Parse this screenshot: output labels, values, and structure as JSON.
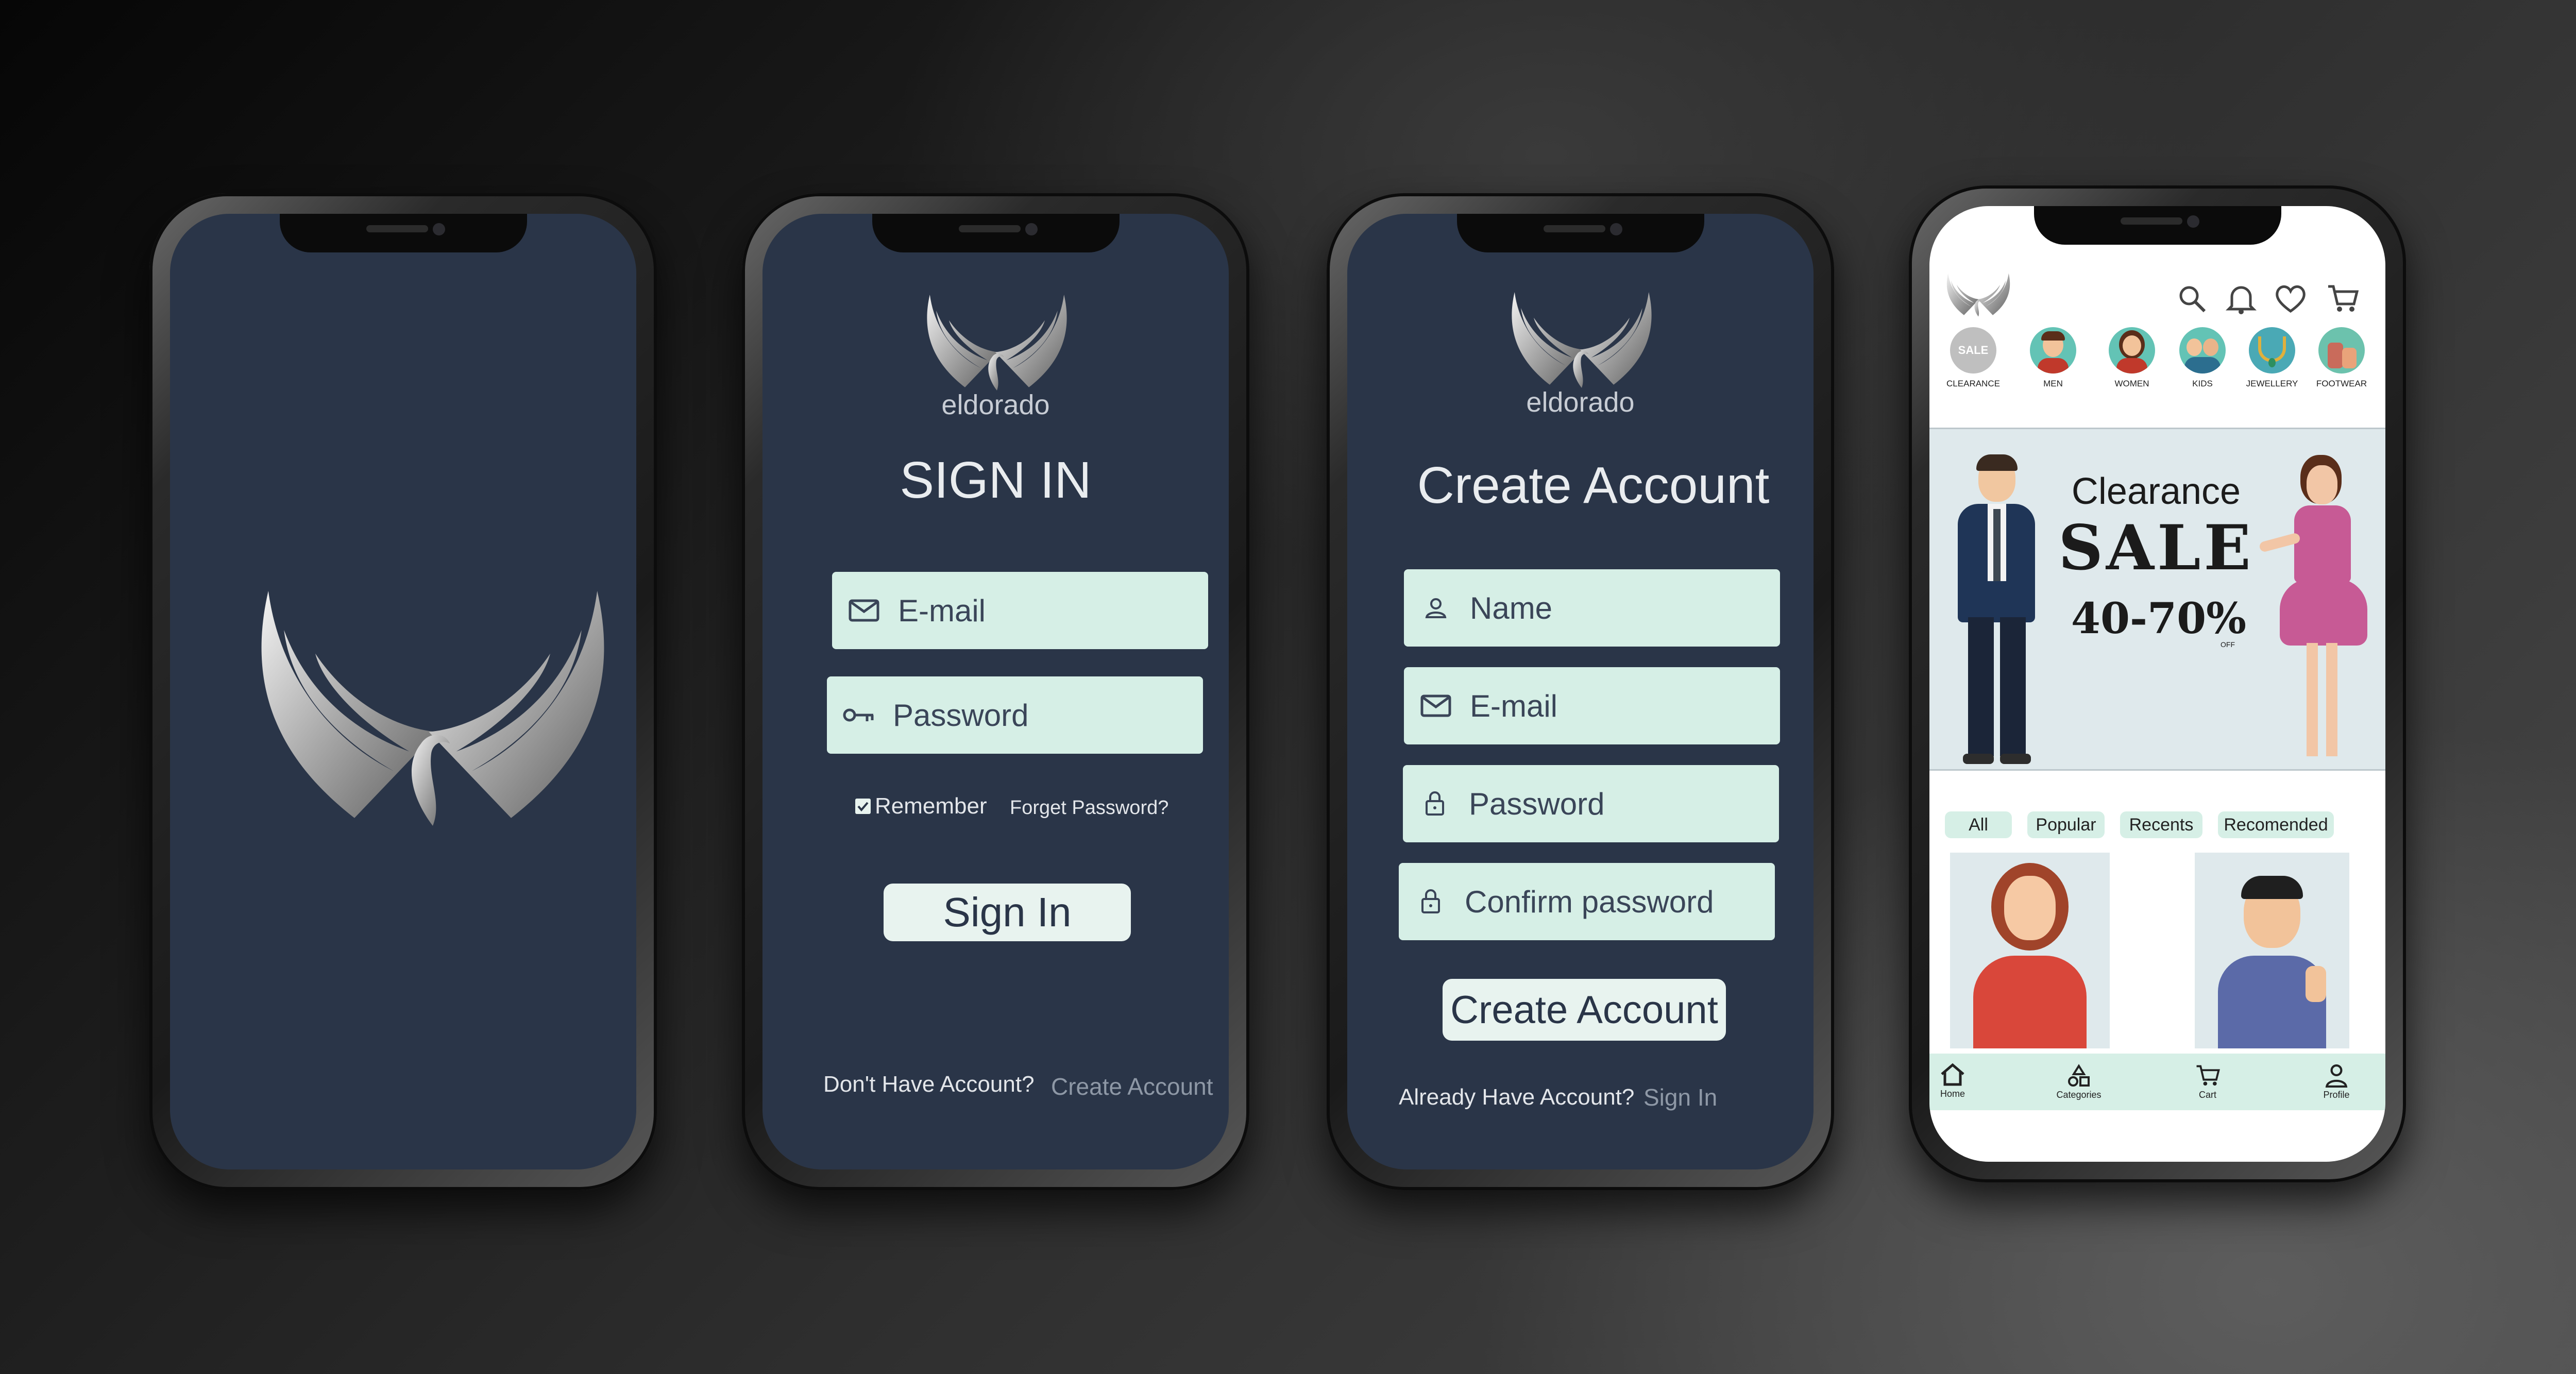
{
  "splash": {
    "logo": "eldorado-wings-logo"
  },
  "signin": {
    "brand": "eldorado",
    "title": "SIGN IN",
    "email_placeholder": "E-mail",
    "password_placeholder": "Password",
    "remember_label": "Remember",
    "forget_label": "Forget Password?",
    "submit_label": "Sign In",
    "no_account_label": "Don't Have Account?",
    "create_link": "Create Account"
  },
  "create": {
    "brand": "eldorado",
    "title": "Create Account",
    "name_placeholder": "Name",
    "email_placeholder": "E-mail",
    "password_placeholder": "Password",
    "confirm_placeholder": "Confirm password",
    "submit_label": "Create Account",
    "have_account_label": "Already Have Account?",
    "signin_link": "Sign In"
  },
  "shop": {
    "categories": [
      "CLEARANCE",
      "MEN",
      "WOMEN",
      "KIDS",
      "JEWELLERY",
      "FOOTWEAR"
    ],
    "clearance_badge": "SALE",
    "banner": {
      "line1": "Clearance",
      "line2": "SALE",
      "line3": "40-70%",
      "off": "OFF"
    },
    "filters": [
      "All",
      "Popular",
      "Recents",
      "Recomended"
    ],
    "nav": [
      "Home",
      "Categories",
      "Cart",
      "Profile"
    ]
  },
  "colors": {
    "screen_dark": "#2a3548",
    "field_mint": "#d6efe6",
    "accent_teal": "#63c3b5"
  }
}
